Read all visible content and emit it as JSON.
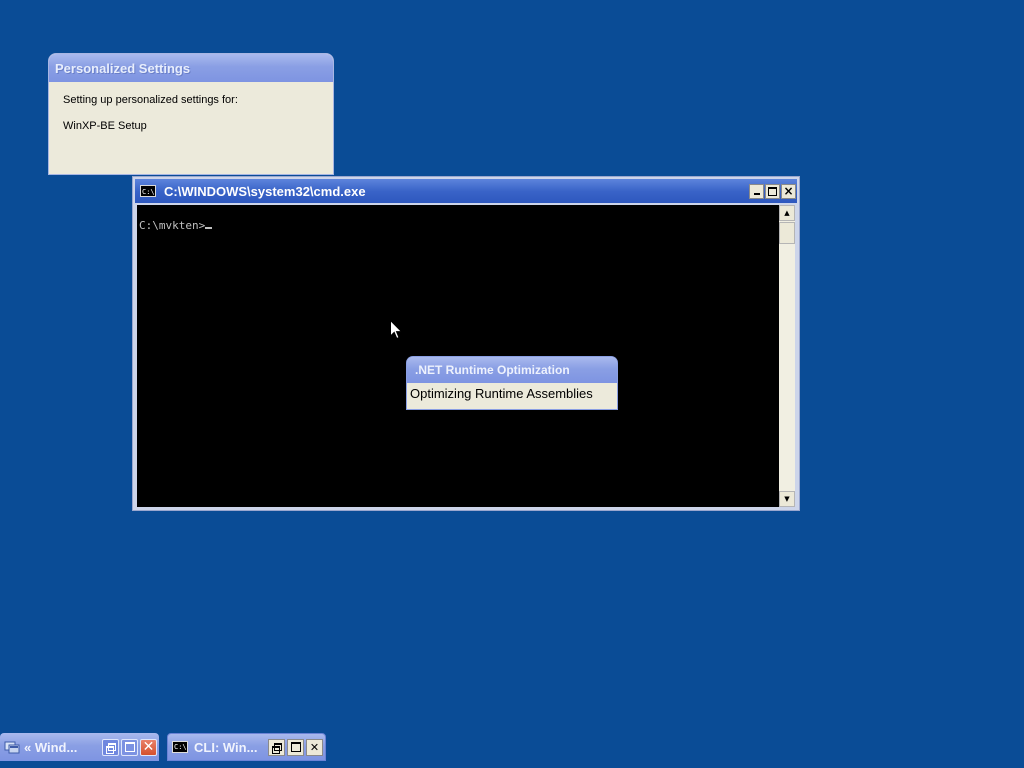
{
  "desktop": {
    "background_color": "#0a4c96"
  },
  "personalized_settings": {
    "title": "Personalized Settings",
    "line1": "Setting up personalized settings for:",
    "line2": "WinXP-BE Setup"
  },
  "cmd_window": {
    "title": "C:\\WINDOWS\\system32\\cmd.exe",
    "icon_label": "C:\\",
    "prompt": "C:\\mvkten>",
    "buttons": {
      "minimize": "minimize",
      "maximize": "maximize",
      "close": "×"
    }
  },
  "net_popup": {
    "title": ".NET Runtime Optimization",
    "message": "Optimizing Runtime Assemblies"
  },
  "minimized_windows": [
    {
      "label": "« Wind...",
      "icon": "explorer-icon"
    },
    {
      "label": "CLI: Win...",
      "icon": "cmd-icon",
      "icon_label": "C:\\"
    }
  ]
}
